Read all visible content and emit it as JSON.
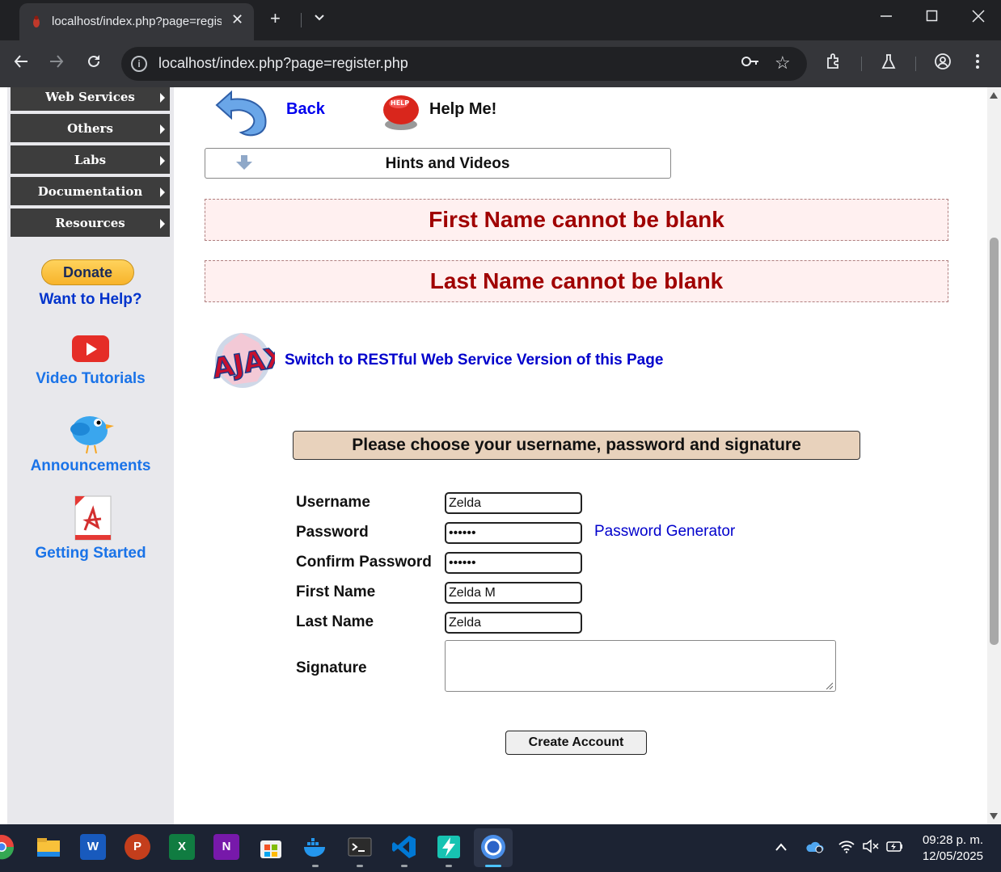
{
  "browser": {
    "tab_title": "localhost/index.php?page=register.php",
    "url": "localhost/index.php?page=register.php",
    "tab_close": "✕",
    "new_tab": "+",
    "dropdown": "⌄"
  },
  "sidebar": {
    "menu": [
      {
        "label": "Web Services"
      },
      {
        "label": "Others"
      },
      {
        "label": "Labs"
      },
      {
        "label": "Documentation"
      },
      {
        "label": "Resources"
      }
    ],
    "donate_label": "Donate",
    "want_help": "Want to Help?",
    "video_tutorials": "Video Tutorials",
    "announcements": "Announcements",
    "getting_started": "Getting Started"
  },
  "main": {
    "back_label": "Back",
    "help_label": "Help Me!",
    "hints_label": "Hints and Videos",
    "errors": [
      "First Name cannot be blank",
      "Last Name cannot be blank"
    ],
    "ajax_link": "Switch to RESTful Web Service Version of this Page"
  },
  "form": {
    "header": "Please choose your username, password and signature",
    "username_label": "Username",
    "username_value": "Zelda",
    "password_label": "Password",
    "password_value": "••••••",
    "password_generator": "Password Generator",
    "confirm_label": "Confirm Password",
    "confirm_value": "••••••",
    "firstname_label": "First Name",
    "firstname_value": "Zelda M",
    "lastname_label": "Last Name",
    "lastname_value": "Zelda",
    "signature_label": "Signature",
    "submit_label": "Create Account"
  },
  "taskbar": {
    "time": "09:28 p. m.",
    "date": "12/05/2025",
    "apps": [
      "chrome-icon",
      "file-explorer-icon",
      "word-icon",
      "powerpoint-icon",
      "excel-icon",
      "onenote-icon",
      "store-icon",
      "docker-icon",
      "terminal-icon",
      "vscode-icon",
      "thunder-app-icon",
      "chromium-icon"
    ]
  },
  "colors": {
    "error_text": "#a00000",
    "error_bg": "#fff0f0",
    "link": "#0000cc",
    "menu_bg": "#3d3d3d",
    "form_header_bg": "#e8d2bc"
  }
}
